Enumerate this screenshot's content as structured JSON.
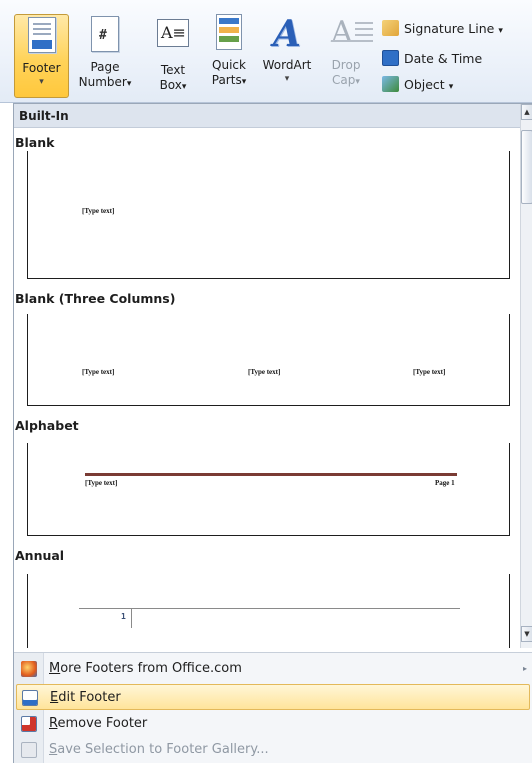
{
  "ribbon": {
    "buttons": [
      {
        "label": "Footer",
        "arrow": "▾"
      },
      {
        "label": "Page",
        "label2": "Number",
        "arrow": "▾"
      },
      {
        "label": "Text",
        "label2": "Box",
        "arrow": "▾"
      },
      {
        "label": "Quick",
        "label2": "Parts",
        "arrow": "▾"
      },
      {
        "label": "WordArt",
        "arrow": "▾"
      },
      {
        "label": "Drop",
        "label2": "Cap",
        "arrow": "▾"
      }
    ],
    "small_commands": [
      {
        "label": "Signature Line",
        "arrow": "▾"
      },
      {
        "label": "Date & Time"
      },
      {
        "label": "Object",
        "arrow": "▾"
      }
    ]
  },
  "menu": {
    "header": "Built-In",
    "sections": [
      {
        "title": "Blank",
        "placeholders": [
          "[Type text]"
        ]
      },
      {
        "title": "Blank (Three Columns)",
        "placeholders": [
          "[Type text]",
          "[Type text]",
          "[Type text]"
        ]
      },
      {
        "title": "Alphabet",
        "placeholders": [
          "[Type text]",
          "Page 1"
        ]
      },
      {
        "title": "Annual",
        "number": "1"
      }
    ],
    "commands": [
      {
        "label": "More Footers from Office.com",
        "underline": "M",
        "rest": "ore Footers from Office.com",
        "submenu_arrow": "▸"
      },
      {
        "label": "Edit Footer",
        "underline": "E",
        "rest": "dit Footer"
      },
      {
        "label": "Remove Footer",
        "underline": "R",
        "rest": "emove Footer"
      },
      {
        "label": "Save Selection to Footer Gallery...",
        "underline": "S",
        "rest": "ave Selection to Footer Gallery..."
      }
    ]
  },
  "colors": {
    "active_button": "#ffd35a",
    "hover_item": "#ffe49a",
    "alphabet_rule": "#7a3b34",
    "header_bg": "#dde4ee"
  },
  "icons": [
    "footer-icon",
    "page-number-icon",
    "text-box-icon",
    "quick-parts-icon",
    "wordart-icon",
    "drop-cap-icon",
    "signature-line-icon",
    "date-time-icon",
    "object-icon",
    "office-online-icon",
    "edit-footer-icon",
    "remove-footer-icon",
    "save-selection-icon"
  ]
}
